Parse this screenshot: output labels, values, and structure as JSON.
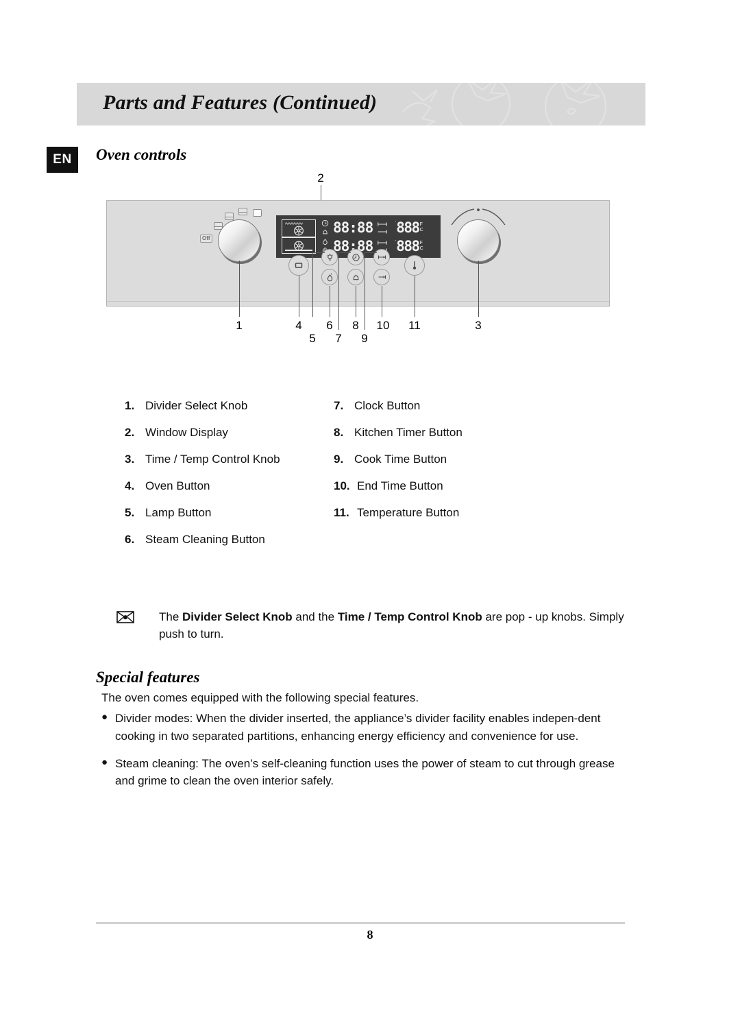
{
  "header": {
    "title": "Parts and Features (Continued)",
    "band_color": "#d8d8d8"
  },
  "language_badge": "EN",
  "sections": {
    "oven_controls_title": "Oven controls",
    "special_features_title": "Special features"
  },
  "diagram": {
    "callout_numbers": [
      "1",
      "2",
      "3",
      "4",
      "5",
      "6",
      "7",
      "8",
      "9",
      "10",
      "11"
    ],
    "knob_left_off_label": "Off",
    "lcd": {
      "row1_time": "88:88",
      "row2_time": "88:88",
      "row1_temp": "888",
      "row2_temp": "888",
      "unit_f": "F",
      "unit_c": "C"
    }
  },
  "legend": {
    "left": [
      {
        "num": "1.",
        "text": "Divider Select Knob"
      },
      {
        "num": "2.",
        "text": "Window Display"
      },
      {
        "num": "3.",
        "text": "Time / Temp Control Knob"
      },
      {
        "num": "4.",
        "text": "Oven Button"
      },
      {
        "num": "5.",
        "text": "Lamp Button"
      },
      {
        "num": "6.",
        "text": "Steam Cleaning Button"
      }
    ],
    "right": [
      {
        "num": "7.",
        "text": "Clock Button"
      },
      {
        "num": "8.",
        "text": "Kitchen Timer Button"
      },
      {
        "num": "9.",
        "text": "Cook Time Button"
      },
      {
        "num": "10.",
        "text": "End Time Button"
      },
      {
        "num": "11.",
        "text": "Temperature Button"
      }
    ]
  },
  "note": {
    "prefix": "The ",
    "bold1": "Divider Select Knob",
    "middle": " and the ",
    "bold2": "Time / Temp Control Knob",
    "suffix": " are pop - up knobs. Simply push to turn."
  },
  "special_features": {
    "intro": "The oven comes equipped with the following special features.",
    "bullets": [
      "Divider modes: When the divider inserted, the appliance’s divider facility enables indepen-dent cooking in two separated partitions, enhancing energy efficiency and convenience for use.",
      "Steam cleaning: The oven’s self-cleaning function uses the power of steam to cut through grease and grime to clean the oven interior safely."
    ],
    "bullet_marker": "●"
  },
  "footer": {
    "page_number": "8"
  }
}
